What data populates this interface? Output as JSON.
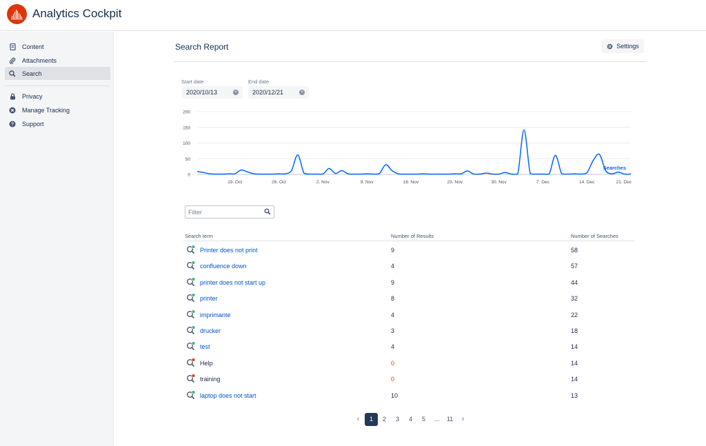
{
  "app": {
    "title": "Analytics Cockpit"
  },
  "sidebar": {
    "items": [
      {
        "label": "Content",
        "icon": "document-icon"
      },
      {
        "label": "Attachments",
        "icon": "paperclip-icon"
      },
      {
        "label": "Search",
        "icon": "search-icon",
        "active": true
      }
    ],
    "secondary_items": [
      {
        "label": "Privacy",
        "icon": "lock-icon"
      },
      {
        "label": "Manage Tracking",
        "icon": "cross-circle-icon"
      },
      {
        "label": "Support",
        "icon": "question-circle-icon"
      }
    ]
  },
  "header": {
    "title": "Search Report",
    "settings_label": "Settings"
  },
  "filters": {
    "start_label": "Start date",
    "start_value": "2020/10/13",
    "end_label": "End date",
    "end_value": "2020/12/21",
    "filter_placeholder": "Filter"
  },
  "chart_data": {
    "type": "line",
    "series": [
      {
        "name": "Searches",
        "color": "#0065ff"
      }
    ],
    "x_ticks": [
      "19. Oct",
      "26. Oct",
      "2. Nov",
      "9. Nov",
      "16. Nov",
      "23. Nov",
      "30. Nov",
      "7. Dec",
      "14. Dec",
      "21. Dec"
    ],
    "y_ticks": [
      "200",
      "150",
      "100",
      "50",
      "0"
    ],
    "ylim": [
      0,
      200
    ],
    "x_start": "2020-10-13",
    "x_end": "2020-12-21",
    "grid": true,
    "points": [
      [
        "2020-10-13",
        9
      ],
      [
        "2020-10-14",
        6
      ],
      [
        "2020-10-15",
        2
      ],
      [
        "2020-10-16",
        1
      ],
      [
        "2020-10-17",
        1
      ],
      [
        "2020-10-18",
        2
      ],
      [
        "2020-10-19",
        2
      ],
      [
        "2020-10-20",
        14
      ],
      [
        "2020-10-21",
        8
      ],
      [
        "2020-10-22",
        2
      ],
      [
        "2020-10-23",
        1
      ],
      [
        "2020-10-24",
        1
      ],
      [
        "2020-10-25",
        1
      ],
      [
        "2020-10-26",
        2
      ],
      [
        "2020-10-27",
        2
      ],
      [
        "2020-10-28",
        12
      ],
      [
        "2020-10-29",
        62
      ],
      [
        "2020-10-30",
        4
      ],
      [
        "2020-10-31",
        1
      ],
      [
        "2020-11-01",
        1
      ],
      [
        "2020-11-02",
        1
      ],
      [
        "2020-11-03",
        19
      ],
      [
        "2020-11-04",
        3
      ],
      [
        "2020-11-05",
        12
      ],
      [
        "2020-11-06",
        2
      ],
      [
        "2020-11-07",
        1
      ],
      [
        "2020-11-08",
        1
      ],
      [
        "2020-11-09",
        2
      ],
      [
        "2020-11-10",
        1
      ],
      [
        "2020-11-11",
        3
      ],
      [
        "2020-11-12",
        31
      ],
      [
        "2020-11-13",
        12
      ],
      [
        "2020-11-14",
        2
      ],
      [
        "2020-11-15",
        1
      ],
      [
        "2020-11-16",
        1
      ],
      [
        "2020-11-17",
        1
      ],
      [
        "2020-11-18",
        2
      ],
      [
        "2020-11-19",
        1
      ],
      [
        "2020-11-20",
        1
      ],
      [
        "2020-11-21",
        1
      ],
      [
        "2020-11-22",
        1
      ],
      [
        "2020-11-23",
        2
      ],
      [
        "2020-11-24",
        2
      ],
      [
        "2020-11-25",
        11
      ],
      [
        "2020-11-26",
        1
      ],
      [
        "2020-11-27",
        1
      ],
      [
        "2020-11-28",
        4
      ],
      [
        "2020-11-29",
        1
      ],
      [
        "2020-11-30",
        1
      ],
      [
        "2020-12-01",
        6
      ],
      [
        "2020-12-02",
        1
      ],
      [
        "2020-12-03",
        1
      ],
      [
        "2020-12-04",
        142
      ],
      [
        "2020-12-05",
        2
      ],
      [
        "2020-12-06",
        1
      ],
      [
        "2020-12-07",
        1
      ],
      [
        "2020-12-08",
        1
      ],
      [
        "2020-12-09",
        61
      ],
      [
        "2020-12-10",
        2
      ],
      [
        "2020-12-11",
        1
      ],
      [
        "2020-12-12",
        2
      ],
      [
        "2020-12-13",
        1
      ],
      [
        "2020-12-14",
        5
      ],
      [
        "2020-12-15",
        44
      ],
      [
        "2020-12-16",
        64
      ],
      [
        "2020-12-17",
        12
      ],
      [
        "2020-12-18",
        2
      ],
      [
        "2020-12-19",
        7
      ],
      [
        "2020-12-20",
        1
      ],
      [
        "2020-12-21",
        1
      ]
    ]
  },
  "table": {
    "headers": {
      "term": "Search term",
      "results": "Number of Results",
      "searches": "Number of Searches"
    },
    "rows": [
      {
        "term": "Printer does not print",
        "results": "9",
        "searches": "58",
        "status": "found"
      },
      {
        "term": "confluence down",
        "results": "4",
        "searches": "57",
        "status": "found"
      },
      {
        "term": "printer does not start up",
        "results": "9",
        "searches": "44",
        "status": "found"
      },
      {
        "term": "printer",
        "results": "8",
        "searches": "32",
        "status": "found"
      },
      {
        "term": "imprimante",
        "results": "4",
        "searches": "22",
        "status": "found"
      },
      {
        "term": "drucker",
        "results": "3",
        "searches": "18",
        "status": "found"
      },
      {
        "term": "test",
        "results": "4",
        "searches": "14",
        "status": "found"
      },
      {
        "term": "Help",
        "results": "0",
        "searches": "14",
        "status": "not-found"
      },
      {
        "term": "training",
        "results": "0",
        "searches": "14",
        "status": "not-found"
      },
      {
        "term": "laptop does not start",
        "results": "10",
        "searches": "13",
        "status": "found"
      }
    ]
  },
  "pagination": {
    "prev": "‹",
    "pages": [
      "1",
      "2",
      "3",
      "4",
      "5",
      "...",
      "11"
    ],
    "current": "1",
    "next": "›"
  },
  "colors": {
    "accent": "#de350b",
    "link": "#0052cc",
    "found": "#36b37e",
    "not_found": "#de350b",
    "line": "#0065ff"
  }
}
